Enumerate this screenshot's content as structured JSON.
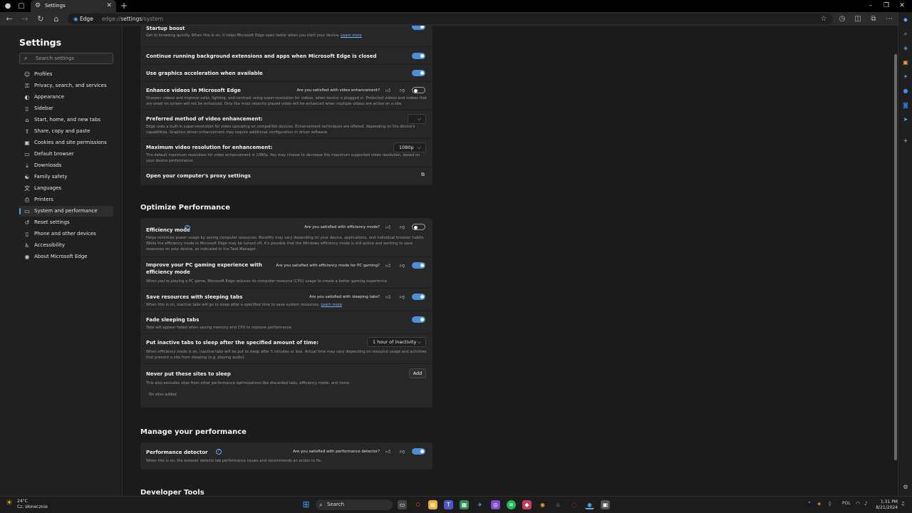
{
  "browser": {
    "tab_title": "Settings",
    "edge_chip": "Edge",
    "url_prefix": "edge://",
    "url_path": "settings",
    "url_suffix": "/system"
  },
  "sidebar": {
    "title": "Settings",
    "search_placeholder": "Search settings",
    "items": [
      {
        "label": "Profiles",
        "icon": "person-icon"
      },
      {
        "label": "Privacy, search, and services",
        "icon": "lock-icon"
      },
      {
        "label": "Appearance",
        "icon": "palette-icon"
      },
      {
        "label": "Sidebar",
        "icon": "sidebar-icon"
      },
      {
        "label": "Start, home, and new tabs",
        "icon": "home-icon"
      },
      {
        "label": "Share, copy and paste",
        "icon": "share-icon"
      },
      {
        "label": "Cookies and site permissions",
        "icon": "cookie-icon"
      },
      {
        "label": "Default browser",
        "icon": "browser-icon"
      },
      {
        "label": "Downloads",
        "icon": "download-icon"
      },
      {
        "label": "Family safety",
        "icon": "family-icon"
      },
      {
        "label": "Languages",
        "icon": "language-icon"
      },
      {
        "label": "Printers",
        "icon": "printer-icon"
      },
      {
        "label": "System and performance",
        "icon": "system-icon"
      },
      {
        "label": "Reset settings",
        "icon": "reset-icon"
      },
      {
        "label": "Phone and other devices",
        "icon": "phone-icon"
      },
      {
        "label": "Accessibility",
        "icon": "accessibility-icon"
      },
      {
        "label": "About Microsoft Edge",
        "icon": "edge-icon"
      }
    ],
    "active_index": 12
  },
  "system": {
    "startup_title": "Startup boost",
    "startup_desc": "Get to browsing quickly. When this is on, it helps Microsoft Edge open faster when you start your device.",
    "learn_more": "Learn more",
    "background_title": "Continue running background extensions and apps when Microsoft Edge is closed",
    "graphics_title": "Use graphics acceleration when available",
    "enhance_title": "Enhance videos in Microsoft Edge",
    "enhance_survey": "Are you satisfied with video enhancement?",
    "enhance_desc": "Sharpen videos and improve color, lighting, and contrast using super-resolution for videos, when device is plugged in. Protected videos and videos that are small on screen will not be enhanced. Only the most recently played video will be enhanced when multiple videos are active on a site.",
    "preferred_title": "Preferred method of video enhancement:",
    "preferred_desc": "Edge uses a built-in super-resolution for video upscaling on compatible devices. Enhancement techniques are offered, depending on the device's capabilities. Graphics driver enhancement may require additional configuration in driver software.",
    "maxres_title": "Maximum video resolution for enhancement:",
    "maxres_value": "1080p",
    "maxres_desc": "The default maximum resolution for video enhancement is 1080p. You may choose to decrease the maximum supported video resolution, based on your device performance.",
    "proxy_title": "Open your computer's proxy settings"
  },
  "optimize": {
    "heading": "Optimize Performance",
    "efficiency_title": "Efficiency mode",
    "efficiency_survey": "Are you satisfied with efficiency mode?",
    "efficiency_desc": "Helps minimize power usage by saving computer resources. Benefits may vary depending on your device, applications, and individual browser habits. While the efficiency mode in Microsoft Edge may be turned off, it's possible that the Windows efficiency mode is still active and working to save resources on your device, as indicated in the Task Manager.",
    "gaming_title": "Improve your PC gaming experience with efficiency mode",
    "gaming_survey": "Are you satisfied with efficiency mode for PC gaming?",
    "gaming_desc": "When you're playing a PC game, Microsoft Edge reduces its computer resource (CPU) usage to create a better gaming experience.",
    "sleeping_title": "Save resources with sleeping tabs",
    "sleeping_survey": "Are you satisfied with sleeping tabs?",
    "sleeping_desc": "When this is on, inactive tabs will go to sleep after a specified time to save system resources.",
    "learn_more": "Learn more",
    "fade_title": "Fade sleeping tabs",
    "fade_desc": "Tabs will appear faded when saving memory and CPU to improve performance.",
    "inactive_title": "Put inactive tabs to sleep after the specified amount of time:",
    "inactive_value": "1 hour of inactivity",
    "inactive_desc": "When efficiency mode is on, inactive tabs will be put to sleep after 5 minutes or less. Actual time may vary depending on resource usage and activities that prevent a site from sleeping (e.g. playing audio).",
    "never_title": "Never put these sites to sleep",
    "add_label": "Add",
    "never_desc": "This also excludes sites from other performance optimizations like discarded tabs, efficiency mode, and more.",
    "no_sites": "No sites added"
  },
  "manage": {
    "heading": "Manage your performance",
    "detector_title": "Performance detector",
    "detector_survey": "Are you satisfied with performance detector?",
    "detector_desc": "When this is on, the browser detects tab performance issues and recommends an action to fix."
  },
  "developer": {
    "heading": "Developer Tools"
  },
  "toggles": {
    "startup": true,
    "background": true,
    "graphics": true,
    "enhance": false,
    "efficiency": false,
    "gaming": true,
    "sleeping": true,
    "fade": true,
    "detector": true
  },
  "taskbar": {
    "weather_temp": "24°C",
    "weather_desc": "Cz. słonecznie",
    "search_label": "Search",
    "lang": "POL",
    "time": "1:31 PM",
    "date": "8/21/2024"
  },
  "colors": {
    "accent": "#4c8ed8",
    "background": "#1b1b1b",
    "card": "#272727"
  }
}
